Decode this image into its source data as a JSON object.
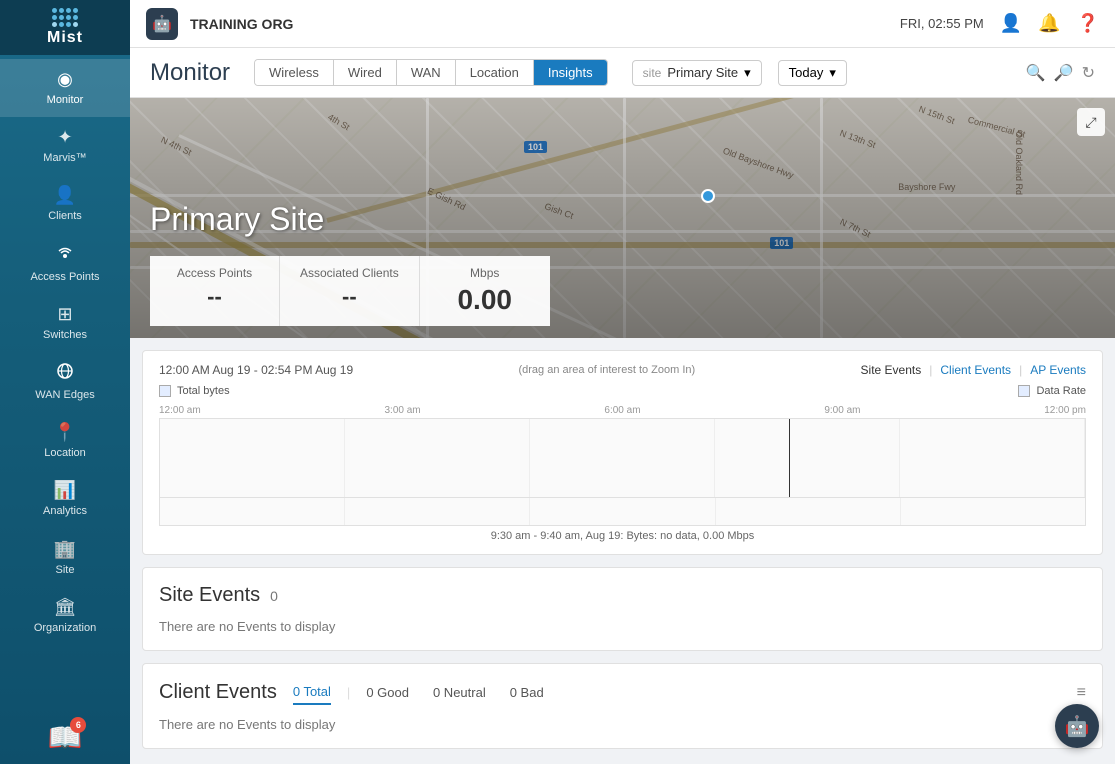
{
  "topbar": {
    "org_name": "TRAINING ORG",
    "time": "FRI, 02:55 PM"
  },
  "sidebar": {
    "items": [
      {
        "id": "monitor",
        "label": "Monitor",
        "icon": "◉",
        "active": true
      },
      {
        "id": "marvis",
        "label": "Marvis™",
        "icon": "✦"
      },
      {
        "id": "clients",
        "label": "Clients",
        "icon": "👤"
      },
      {
        "id": "access-points",
        "label": "Access Points",
        "icon": "📡"
      },
      {
        "id": "switches",
        "label": "Switches",
        "icon": "⊞"
      },
      {
        "id": "wan-edges",
        "label": "WAN Edges",
        "icon": "+"
      },
      {
        "id": "location",
        "label": "Location",
        "icon": "📍"
      },
      {
        "id": "analytics",
        "label": "Analytics",
        "icon": "📊"
      },
      {
        "id": "site",
        "label": "Site",
        "icon": "🏢"
      },
      {
        "id": "organization",
        "label": "Organization",
        "icon": "🏛"
      }
    ],
    "notification_count": "6"
  },
  "monitor": {
    "page_title": "Monitor",
    "tabs": [
      {
        "id": "wireless",
        "label": "Wireless"
      },
      {
        "id": "wired",
        "label": "Wired"
      },
      {
        "id": "wan",
        "label": "WAN"
      },
      {
        "id": "location",
        "label": "Location"
      },
      {
        "id": "insights",
        "label": "Insights",
        "active": true
      }
    ],
    "site_label": "site",
    "site_name": "Primary Site",
    "date_range": "Today",
    "map_title": "Primary Site",
    "stats": [
      {
        "label": "Access Points",
        "value": "--"
      },
      {
        "label": "Associated Clients",
        "value": "--"
      },
      {
        "label": "Mbps",
        "value": "0.00"
      }
    ],
    "chart": {
      "time_range": "12:00 AM Aug 19 - 02:54 PM Aug 19",
      "hint": "(drag an area of interest to Zoom In)",
      "links": [
        {
          "label": "Site Events",
          "active": true
        },
        {
          "label": "Client Events"
        },
        {
          "label": "AP Events"
        }
      ],
      "legend_left": "Total bytes",
      "legend_right": "Data Rate",
      "time_labels": [
        "12:00 am",
        "3:00 am",
        "6:00 am",
        "9:00 am",
        "12:00 pm"
      ],
      "status_text": "9:30 am - 9:40 am, Aug 19: Bytes: no data, 0.00 Mbps"
    },
    "site_events": {
      "title": "Site Events",
      "count": "0",
      "empty_message": "There are no Events to display"
    },
    "client_events": {
      "title": "Client Events",
      "total_label": "0 Total",
      "good_label": "0 Good",
      "neutral_label": "0 Neutral",
      "bad_label": "0 Bad",
      "empty_message": "There are no Events to display"
    }
  }
}
